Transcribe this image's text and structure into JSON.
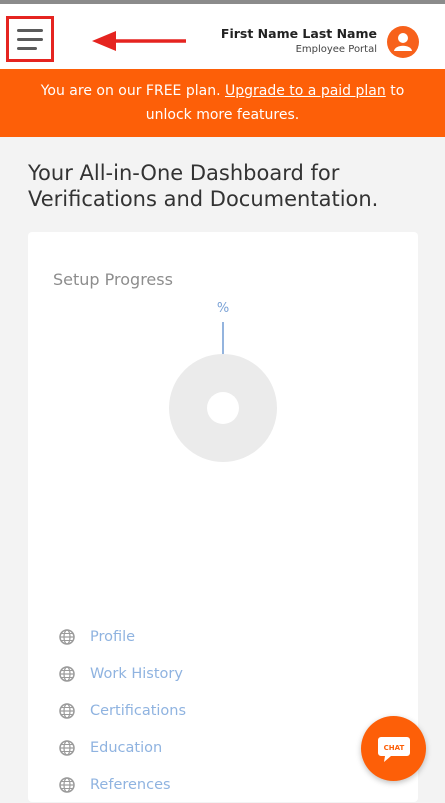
{
  "header": {
    "user_name": "First Name Last Name",
    "user_role": "Employee Portal",
    "menu_icon": "hamburger-menu-icon",
    "avatar_icon": "user-avatar-icon"
  },
  "banner": {
    "text_before": "You are on our FREE plan. ",
    "link_text": "Upgrade to a paid plan",
    "text_after": " to unlock more features."
  },
  "page": {
    "title": "Your All-in-One Dashboard for Verifications and Documentation."
  },
  "setup_progress": {
    "title": "Setup Progress",
    "percent_label": "%",
    "items": [
      {
        "label": "Profile"
      },
      {
        "label": "Work History"
      },
      {
        "label": "Certifications"
      },
      {
        "label": "Education"
      },
      {
        "label": "References"
      }
    ]
  },
  "chat": {
    "label": "CHAT"
  },
  "colors": {
    "brand_orange": "#fd5f08",
    "annotation_red": "#e52420",
    "link_blue": "#8fb3e0"
  }
}
